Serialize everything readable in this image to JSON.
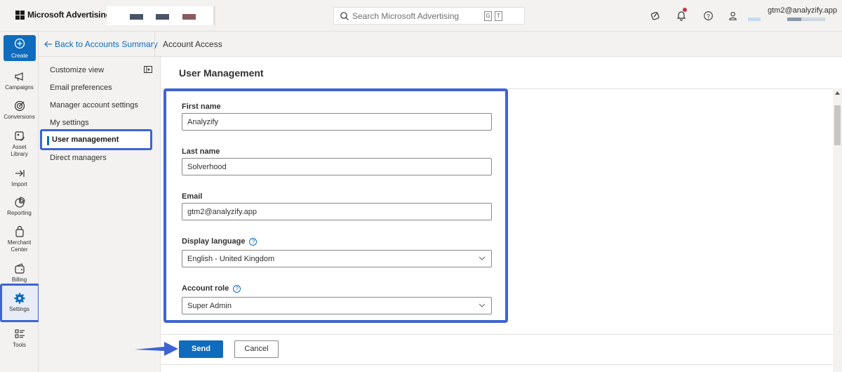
{
  "header": {
    "brand": "Microsoft Advertising",
    "search_placeholder": "Search Microsoft Advertising",
    "shortcut_keys": [
      "G",
      "T"
    ],
    "user_email": "gtm2@analyzify.app",
    "account_chip_colors": [
      "#4a5466",
      "#4a5466",
      "#8a5b5f"
    ]
  },
  "rail": {
    "create_label": "Create",
    "items": [
      {
        "label": "Campaigns",
        "icon": "megaphone-icon"
      },
      {
        "label": "Conversions",
        "icon": "target-icon"
      },
      {
        "label": "Asset Library",
        "icon": "image-edit-icon"
      },
      {
        "label": "Import",
        "icon": "import-arrow-icon"
      },
      {
        "label": "Reporting",
        "icon": "pie-chart-icon"
      },
      {
        "label": "Merchant Center",
        "icon": "shopping-bag-icon"
      },
      {
        "label": "Billing",
        "icon": "wallet-icon"
      },
      {
        "label": "Settings",
        "icon": "gear-icon"
      },
      {
        "label": "Tools",
        "icon": "tools-list-icon"
      }
    ]
  },
  "subnav": {
    "back_label": "Back to Accounts Summary",
    "title": "Account Access"
  },
  "side": {
    "items": [
      "Customize view",
      "Email preferences",
      "Manager account settings",
      "My settings",
      "User management",
      "Direct managers"
    ]
  },
  "main": {
    "title": "User Management",
    "fields": {
      "first_name_label": "First name",
      "first_name_value": "Analyzify",
      "last_name_label": "Last name",
      "last_name_value": "Solverhood",
      "email_label": "Email",
      "email_value": "gtm2@analyzify.app",
      "language_label": "Display language",
      "language_value": "English - United Kingdom",
      "role_label": "Account role",
      "role_value": "Super Admin"
    },
    "send_label": "Send",
    "cancel_label": "Cancel"
  },
  "colors": {
    "accent": "#0f6cbd",
    "highlight": "#3e64d2"
  }
}
